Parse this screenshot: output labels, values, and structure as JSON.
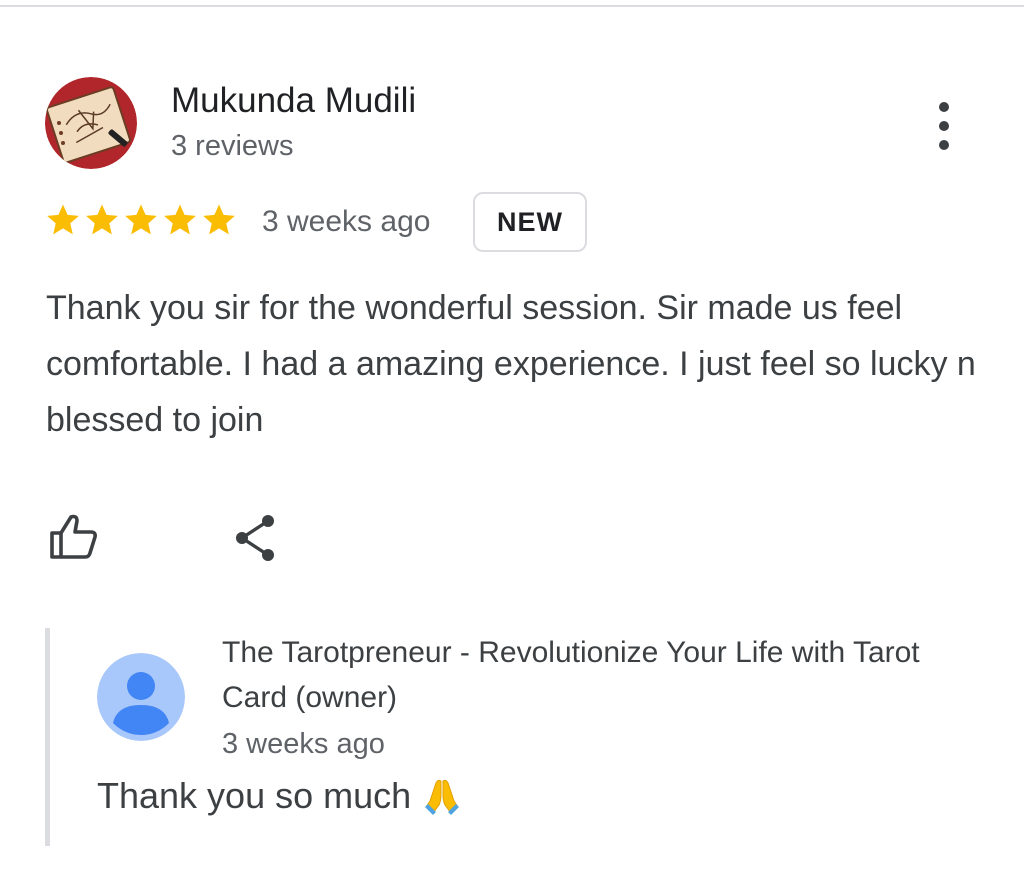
{
  "review": {
    "reviewer_name": "Mukunda Mudili",
    "reviewer_reviews": "3 reviews",
    "rating": 5,
    "rating_max": 5,
    "time": "3 weeks ago",
    "badge": "NEW",
    "text": "Thank you sir for the wonderful session. Sir made us feel comfortable. I had a amazing experience. I just feel so lucky n blessed to join"
  },
  "actions": {
    "like_icon": "thumb-up-icon",
    "share_icon": "share-icon",
    "more_icon": "more-vert-icon"
  },
  "owner_reply": {
    "name": "The Tarotpreneur - Revolutionize Your Life with Tarot Card (owner)",
    "time": "3 weeks ago",
    "text": "Thank you so much",
    "emoji_icon": "folded-hands-icon"
  },
  "colors": {
    "star": "#fbbc04",
    "owner_avatar_bg": "#a8c7fa",
    "owner_avatar_fg": "#4285f4",
    "divider": "#dadce0"
  }
}
